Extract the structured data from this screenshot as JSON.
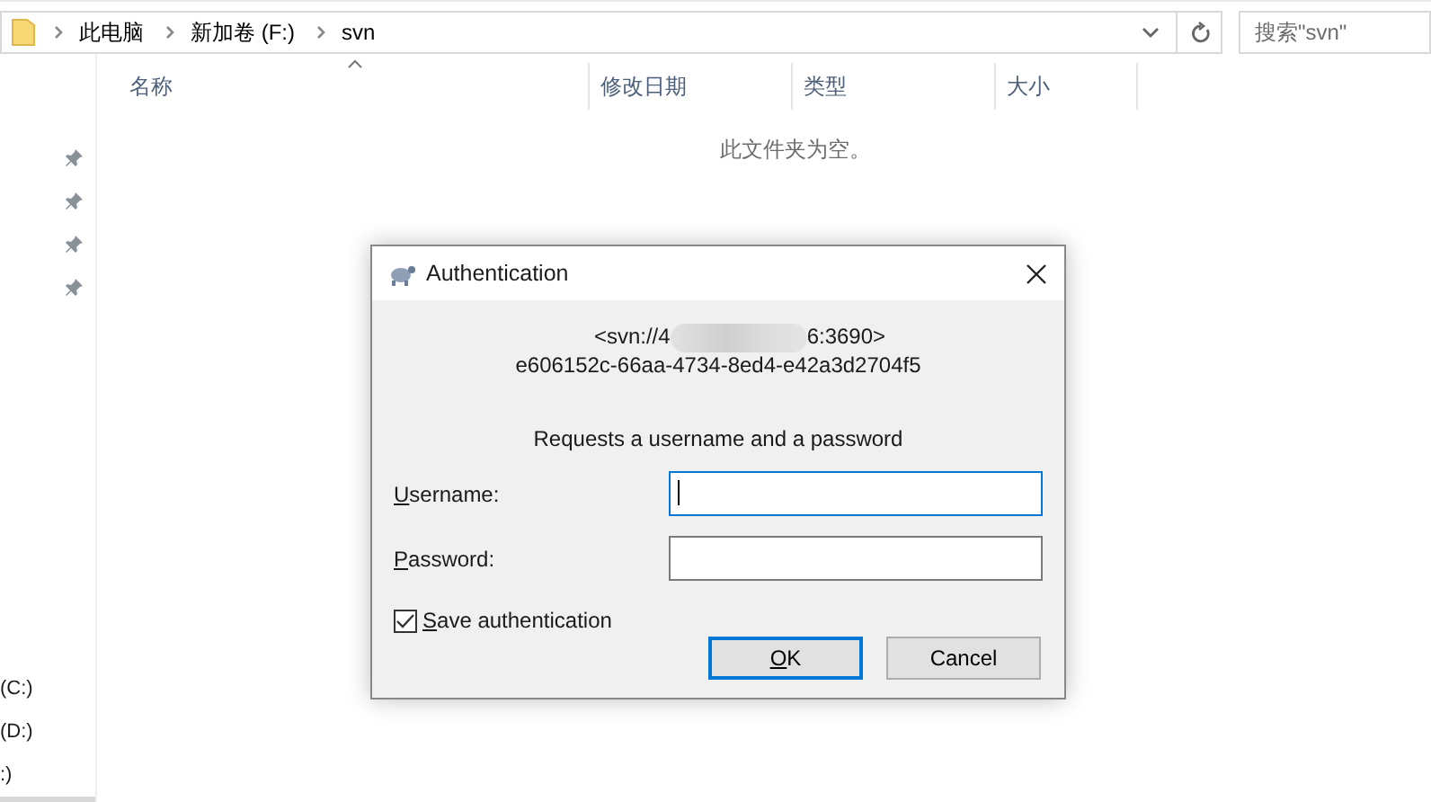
{
  "address_bar": {
    "crumbs": [
      {
        "label": "此电脑"
      },
      {
        "label": "新加卷 (F:)"
      },
      {
        "label": "svn"
      }
    ]
  },
  "search": {
    "placeholder": "搜索\"svn\""
  },
  "columns": [
    {
      "label": "名称"
    },
    {
      "label": "修改日期"
    },
    {
      "label": "类型"
    },
    {
      "label": "大小"
    }
  ],
  "empty_message": "此文件夹为空。",
  "sidebar": {
    "drives": [
      {
        "label": "(C:)"
      },
      {
        "label": "(D:)"
      },
      {
        "label": ":)"
      }
    ]
  },
  "dialog": {
    "title": "Authentication",
    "server_prefix": "<svn://4",
    "server_suffix": "6:3690>",
    "realm": "e606152c-66aa-4734-8ed4-e42a3d2704f5",
    "prompt": "Requests a username and a password",
    "fields": [
      {
        "label": "Username:",
        "focused": true,
        "mnemonic": true
      },
      {
        "label": "Password:",
        "focused": false,
        "mnemonic": true
      }
    ],
    "save": {
      "label": "Save authentication",
      "checked": true,
      "mnemonic": true
    },
    "buttons": [
      {
        "label": "OK",
        "default": true,
        "mnemonic": true
      },
      {
        "label": "Cancel",
        "default": false,
        "mnemonic": false
      }
    ]
  }
}
